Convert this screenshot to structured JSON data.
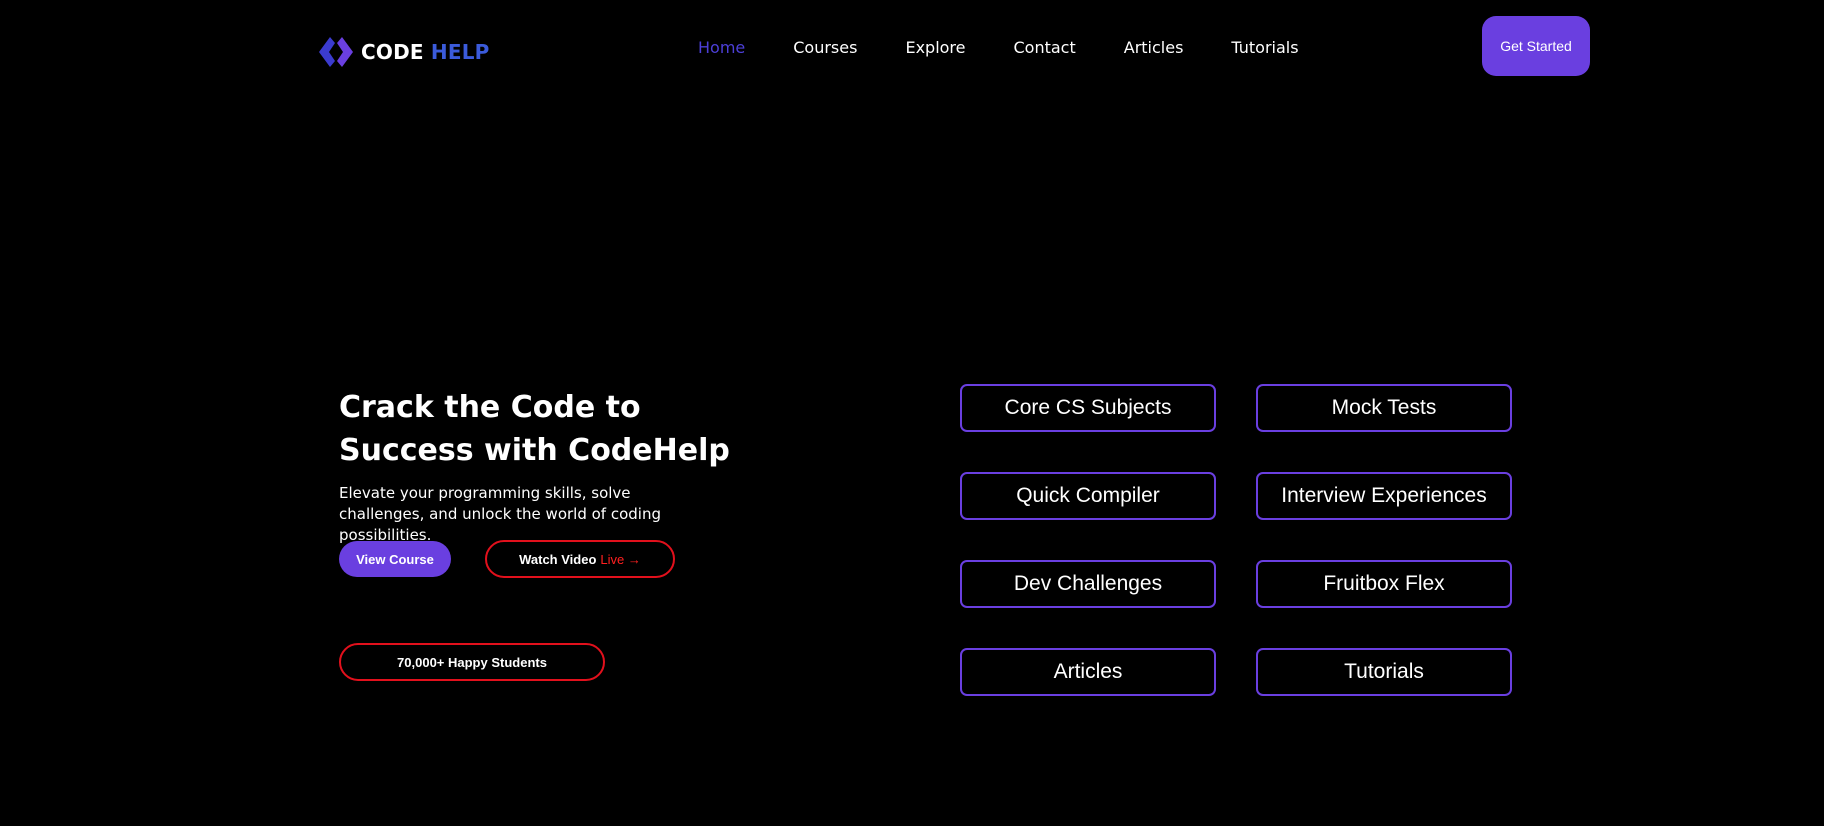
{
  "header": {
    "logo": {
      "code": "CODE",
      "help": "HELP",
      "icon": "code-brackets-icon"
    },
    "nav": [
      {
        "label": "Home",
        "active": true
      },
      {
        "label": "Courses",
        "active": false
      },
      {
        "label": "Explore",
        "active": false
      },
      {
        "label": "Contact",
        "active": false
      },
      {
        "label": "Articles",
        "active": false
      },
      {
        "label": "Tutorials",
        "active": false
      }
    ],
    "cta_label": "Get Started"
  },
  "hero": {
    "title": "Crack the Code to Success with CodeHelp",
    "subtitle": "Elevate your programming skills, solve challenges, and unlock the world of coding possibilities.",
    "view_course_label": "View Course",
    "watch_video_label": "Watch Video",
    "live_label": "Live →",
    "students_badge": "70,000+ Happy Students"
  },
  "features": [
    "Core CS Subjects",
    "Mock Tests",
    "Quick Compiler",
    "Interview Experiences",
    "Dev Challenges",
    "Fruitbox Flex",
    "Articles",
    "Tutorials"
  ],
  "colors": {
    "background": "#000000",
    "accent": "#6a3fe0",
    "nav_active": "#4c3fd8",
    "logo_help": "#3b5bdb",
    "live_red": "#ff2020",
    "outline_red": "#e2101c"
  }
}
